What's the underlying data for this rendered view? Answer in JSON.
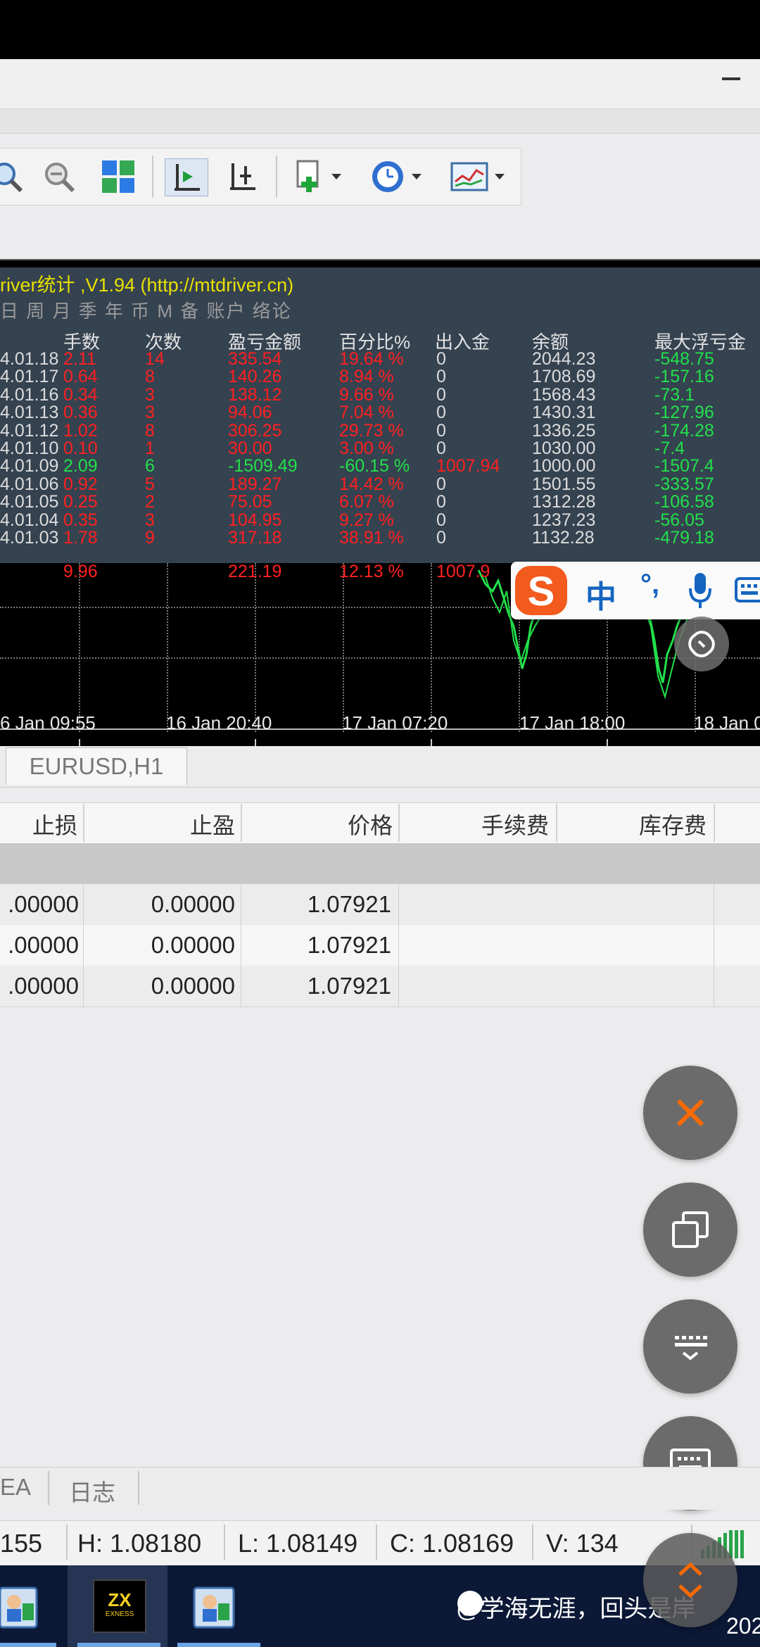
{
  "indicator": {
    "title": "river统计 ,V1.94 (http://mtdriver.cn)",
    "menu": "日 周 月 季 年 币 M 备 账户  络论"
  },
  "stats": {
    "headers": [
      "手数",
      "次数",
      "盈亏金额",
      "百分比%",
      "出入金",
      "余额",
      "最大浮亏金"
    ],
    "rows": [
      {
        "date": "4.01.18",
        "lots": "2.11",
        "count": "14",
        "pnl": "335.54",
        "pct": "19.64 %",
        "io": "0",
        "balance": "2044.23",
        "maxdd": "-548.75",
        "tone": "red"
      },
      {
        "date": "4.01.17",
        "lots": "0.64",
        "count": "8",
        "pnl": "140.26",
        "pct": "8.94 %",
        "io": "0",
        "balance": "1708.69",
        "maxdd": "-157.16",
        "tone": "red"
      },
      {
        "date": "4.01.16",
        "lots": "0.34",
        "count": "3",
        "pnl": "138.12",
        "pct": "9.66 %",
        "io": "0",
        "balance": "1568.43",
        "maxdd": "-73.1",
        "tone": "red"
      },
      {
        "date": "4.01.13",
        "lots": "0.36",
        "count": "3",
        "pnl": "94.06",
        "pct": "7.04 %",
        "io": "0",
        "balance": "1430.31",
        "maxdd": "-127.96",
        "tone": "red"
      },
      {
        "date": "4.01.12",
        "lots": "1.02",
        "count": "8",
        "pnl": "306.25",
        "pct": "29.73 %",
        "io": "0",
        "balance": "1336.25",
        "maxdd": "-174.28",
        "tone": "red"
      },
      {
        "date": "4.01.10",
        "lots": "0.10",
        "count": "1",
        "pnl": "30.00",
        "pct": "3.00 %",
        "io": "0",
        "balance": "1030.00",
        "maxdd": "-7.4",
        "tone": "red"
      },
      {
        "date": "4.01.09",
        "lots": "2.09",
        "count": "6",
        "pnl": "-1509.49",
        "pct": "-60.15 %",
        "io": "1007.94",
        "balance": "1000.00",
        "maxdd": "-1507.4",
        "tone": "grn"
      },
      {
        "date": "4.01.06",
        "lots": "0.92",
        "count": "5",
        "pnl": "189.27",
        "pct": "14.42 %",
        "io": "0",
        "balance": "1501.55",
        "maxdd": "-333.57",
        "tone": "red"
      },
      {
        "date": "4.01.05",
        "lots": "0.25",
        "count": "2",
        "pnl": "75.05",
        "pct": "6.07 %",
        "io": "0",
        "balance": "1312.28",
        "maxdd": "-106.58",
        "tone": "red"
      },
      {
        "date": "4.01.04",
        "lots": "0.35",
        "count": "3",
        "pnl": "104.95",
        "pct": "9.27 %",
        "io": "0",
        "balance": "1237.23",
        "maxdd": "-56.05",
        "tone": "red"
      },
      {
        "date": "4.01.03",
        "lots": "1.78",
        "count": "9",
        "pnl": "317.18",
        "pct": "38.91 %",
        "io": "0",
        "balance": "1132.28",
        "maxdd": "-479.18",
        "tone": "red"
      }
    ],
    "total": {
      "lots": "9.96",
      "pnl": "221.19",
      "pct": "12.13 %",
      "io": "1007.9"
    }
  },
  "chart": {
    "time_labels": [
      "6 Jan 09:55",
      "16 Jan 20:40",
      "17 Jan 07:20",
      "17 Jan 18:00",
      "18 Jan 0"
    ]
  },
  "ime": {
    "zh": "中",
    "dot": "°,"
  },
  "tabs": {
    "active": "EURUSD,H1"
  },
  "trade_table": {
    "headers": [
      "止损",
      "止盈",
      "价格",
      "手续费",
      "库存费"
    ],
    "rows": [
      {
        "sl": ".00000",
        "tp": "0.00000",
        "price": "1.07921"
      },
      {
        "sl": ".00000",
        "tp": "0.00000",
        "price": "1.07921"
      },
      {
        "sl": ".00000",
        "tp": "0.00000",
        "price": "1.07921"
      }
    ]
  },
  "bottom_tabs": [
    "EA",
    "日志"
  ],
  "status": {
    "o": "155",
    "h": "H: 1.08180",
    "l": "L: 1.08149",
    "c": "C: 1.08169",
    "v": "V: 134"
  },
  "taskbar": {
    "watermark": "@学海无涯，回头是岸",
    "year": "202",
    "exness": "EXNESS"
  },
  "colors": {
    "profit_red": "#ff2020",
    "loss_green": "#22e04a",
    "panel_bg": "#354250",
    "fab_bg": "#6b6b6b",
    "fab_close": "#ff6a00"
  }
}
